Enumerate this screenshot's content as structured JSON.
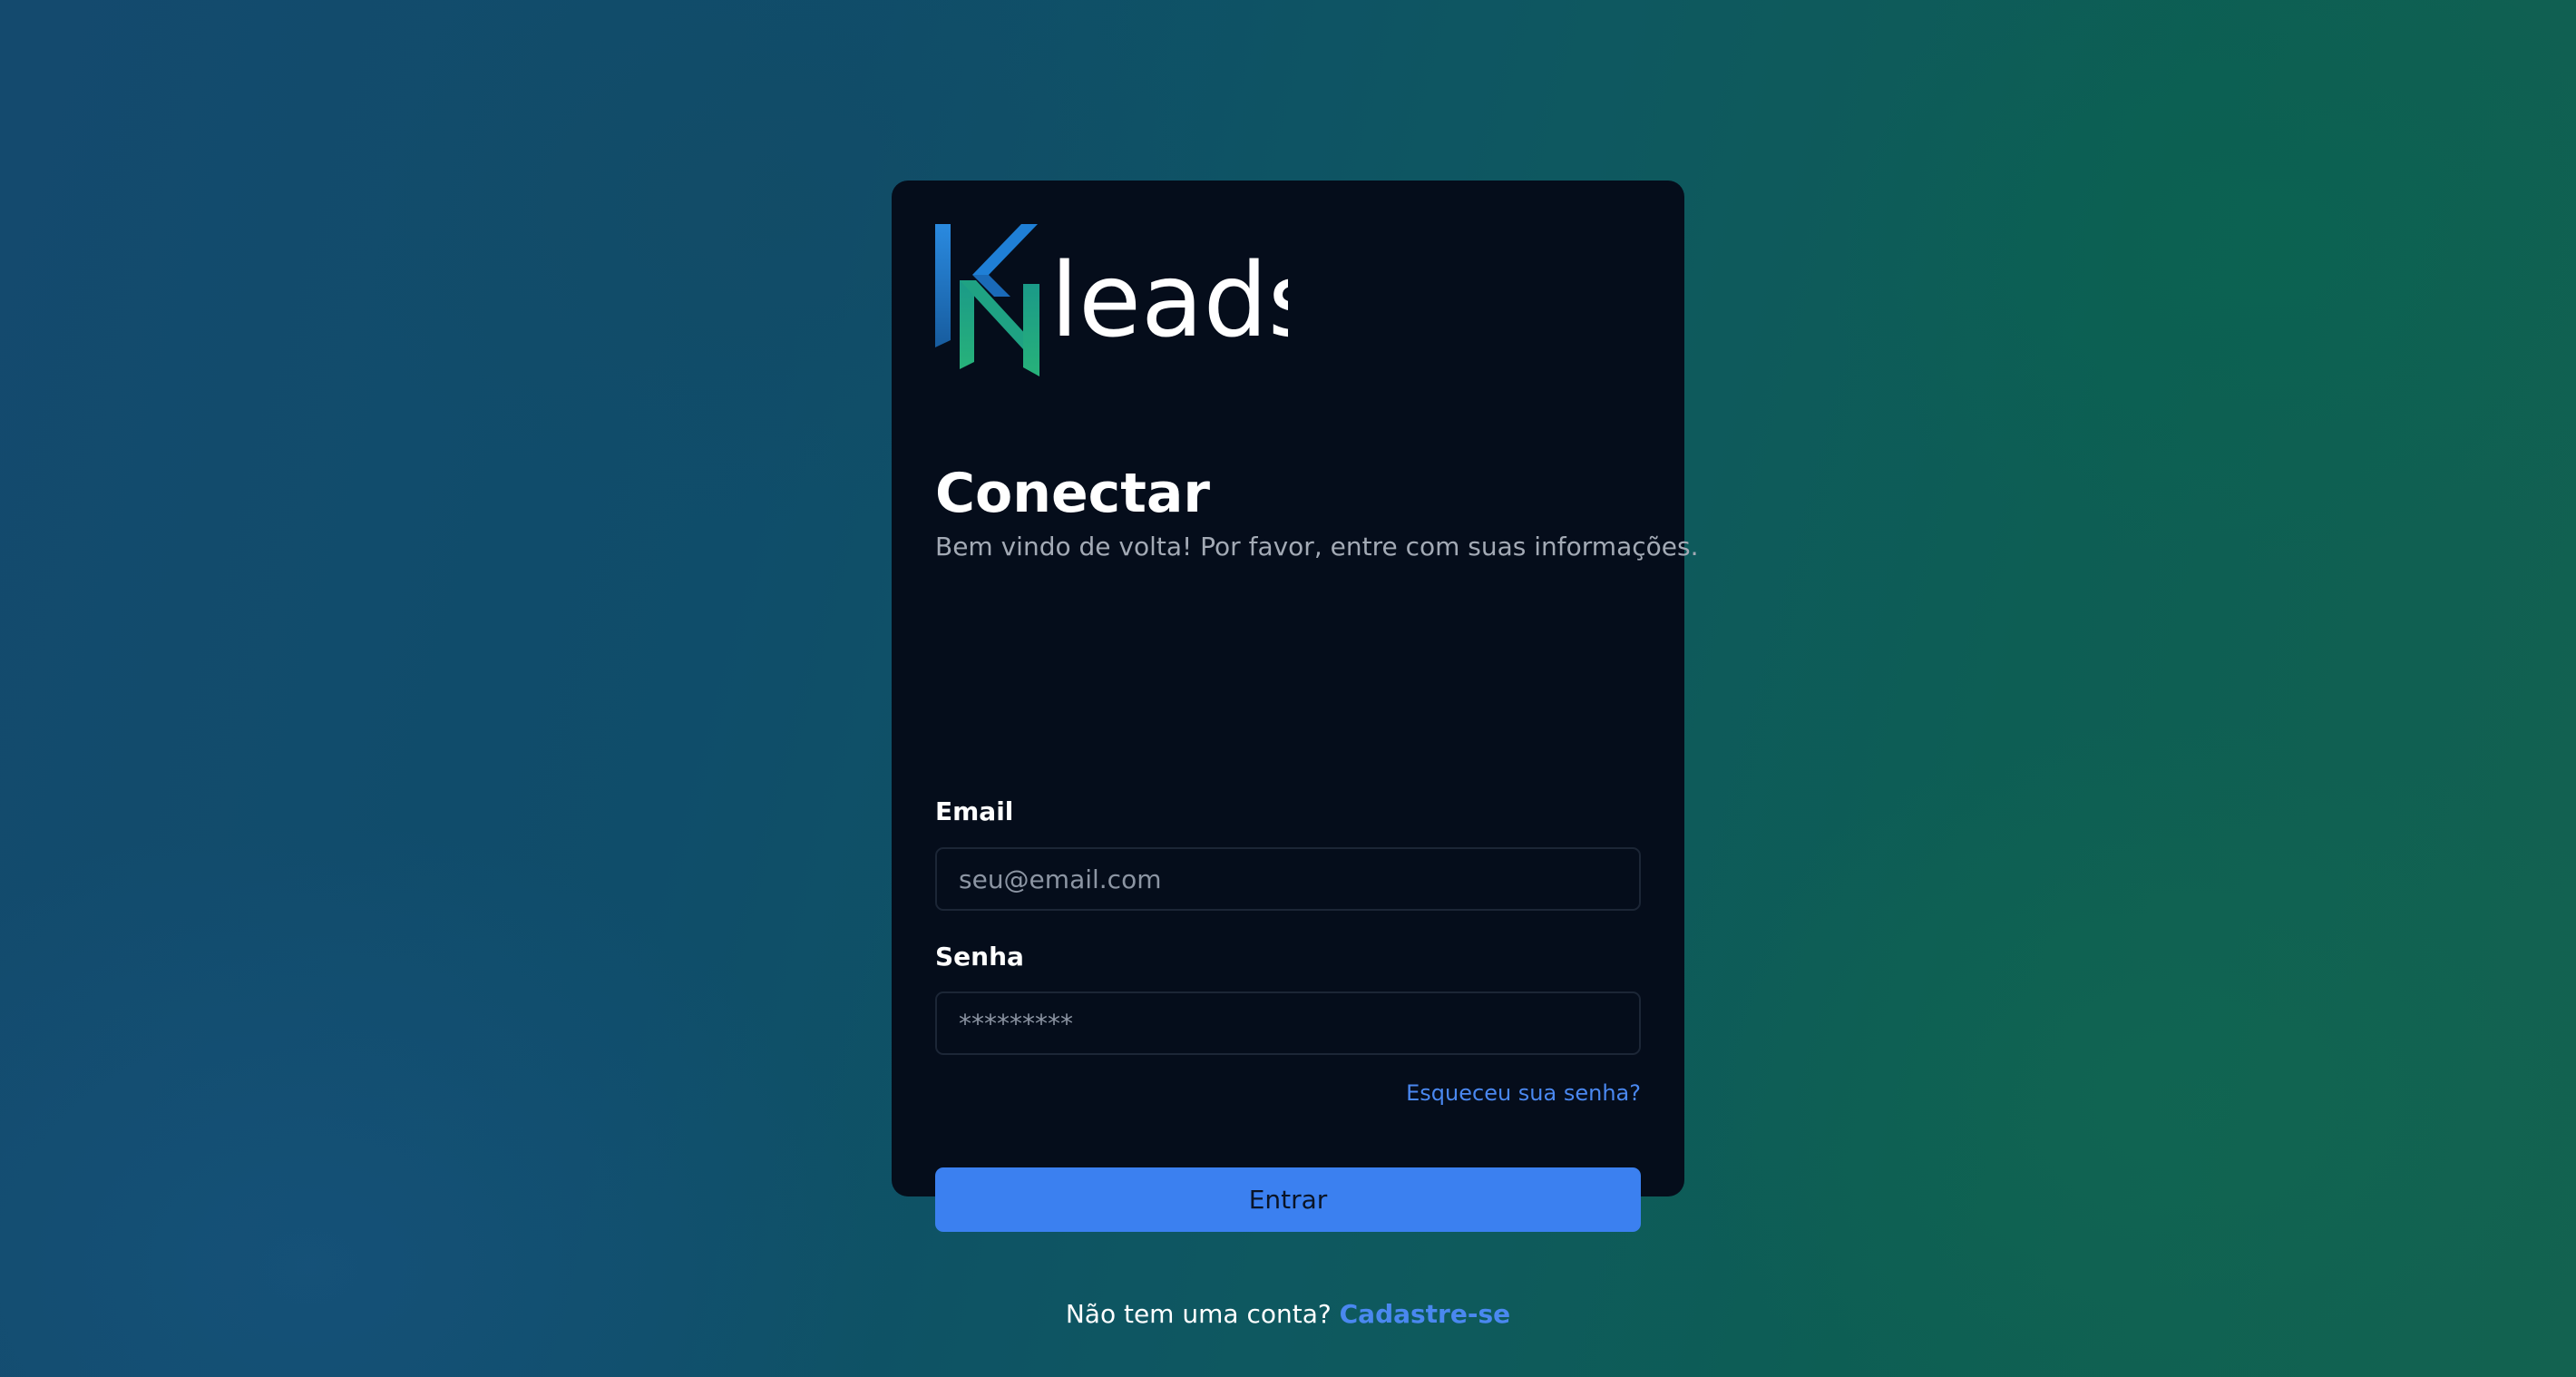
{
  "brand": {
    "logo_text": "leads",
    "logo_colors": {
      "blue": "#1f7fd6",
      "teal": "#22b07c",
      "text": "#ffffff"
    }
  },
  "login": {
    "title": "Conectar",
    "subtitle": "Bem vindo de volta! Por favor, entre com suas informações.",
    "email_label": "Email",
    "email_placeholder": "seu@email.com",
    "password_label": "Senha",
    "password_placeholder": "*********",
    "forgot_link": "Esqueceu sua senha?",
    "submit_label": "Entrar",
    "signup_prompt": "Não tem uma conta?",
    "signup_link": "Cadastre-se"
  },
  "colors": {
    "card_bg": "#050d1b",
    "accent": "#3b80f0",
    "link": "#4a88f0",
    "muted_text": "#a3aab5"
  }
}
